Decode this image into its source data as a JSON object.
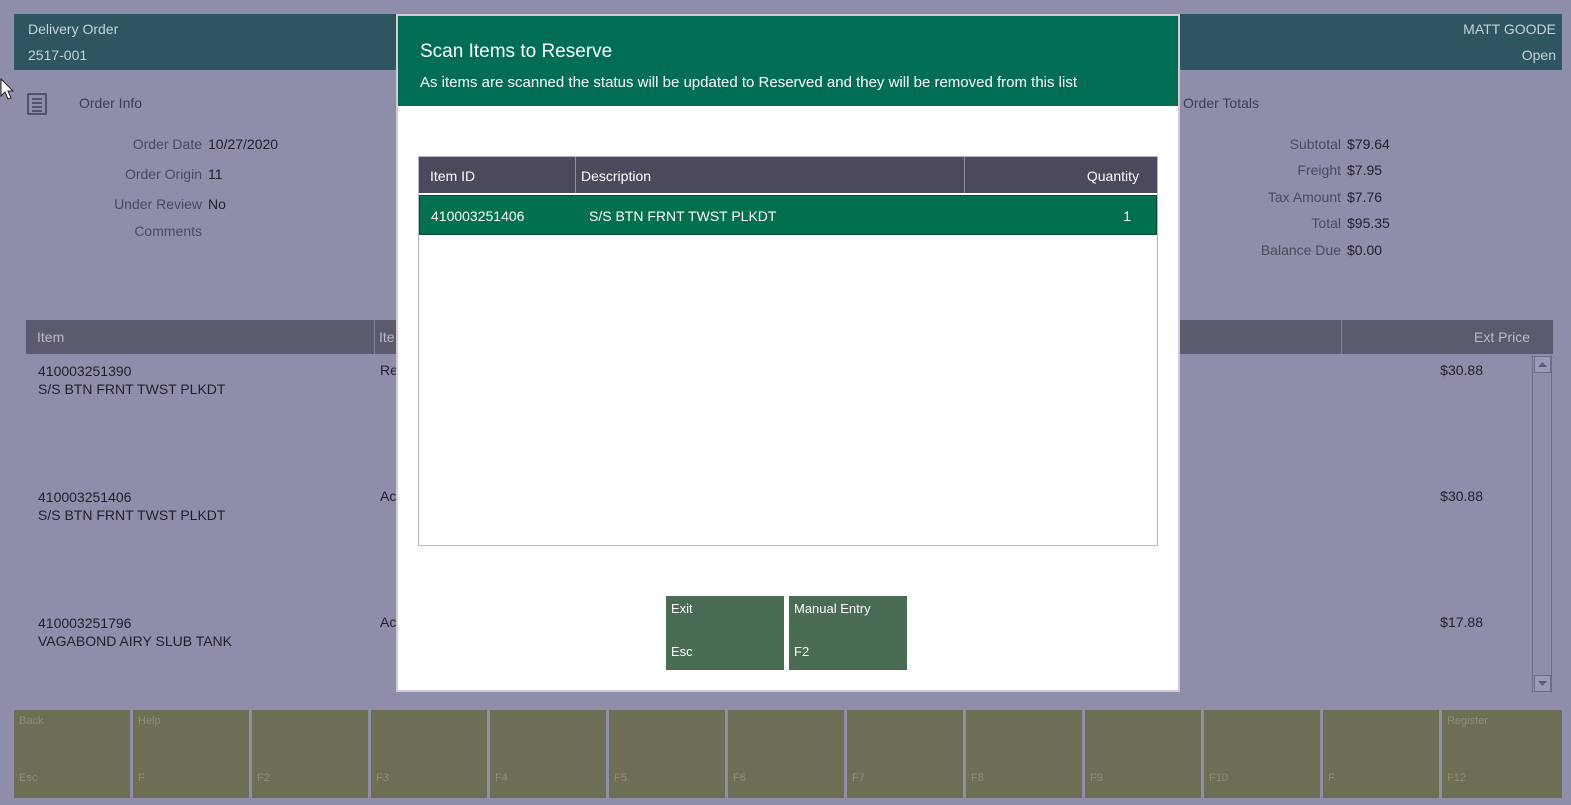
{
  "header": {
    "order_type": "Delivery Order",
    "order_number": "2517-001",
    "user_name": "MATT GOODE",
    "order_status": "Open"
  },
  "order_info": {
    "label": "Order Info",
    "fields": [
      {
        "label": "Order Date",
        "value": "10/27/2020"
      },
      {
        "label": "Order Origin",
        "value": "11"
      },
      {
        "label": "Under Review",
        "value": "No"
      },
      {
        "label": "Comments",
        "value": ""
      }
    ]
  },
  "order_totals": {
    "label": "Order Totals",
    "fields": [
      {
        "label": "Subtotal",
        "value": "$79.64"
      },
      {
        "label": "Freight",
        "value": "$7.95"
      },
      {
        "label": "Tax Amount",
        "value": "$7.76"
      },
      {
        "label": "Total",
        "value": "$95.35"
      },
      {
        "label": "Balance Due",
        "value": "$0.00"
      }
    ]
  },
  "lines": {
    "columns": {
      "item": "Item",
      "item_status": "Ite",
      "ext_price": "Ext Price"
    },
    "rows": [
      {
        "id": "410003251390",
        "desc": "S/S BTN FRNT TWST PLKDT",
        "status": "Re",
        "price": "$30.88"
      },
      {
        "id": "410003251406",
        "desc": "S/S BTN FRNT TWST PLKDT",
        "status": "Ac",
        "price": "$30.88"
      },
      {
        "id": "410003251796",
        "desc": "VAGABOND AIRY SLUB TANK",
        "status": "Ac",
        "price": "$17.88"
      }
    ]
  },
  "function_keys": [
    {
      "label": "Back",
      "key": "Esc"
    },
    {
      "label": "Help",
      "key": "F"
    },
    {
      "label": "",
      "key": "F2"
    },
    {
      "label": "",
      "key": "F3"
    },
    {
      "label": "",
      "key": "F4"
    },
    {
      "label": "",
      "key": "F5"
    },
    {
      "label": "",
      "key": "F6"
    },
    {
      "label": "",
      "key": "F7"
    },
    {
      "label": "",
      "key": "F8"
    },
    {
      "label": "",
      "key": "F9"
    },
    {
      "label": "",
      "key": "F10"
    },
    {
      "label": "",
      "key": "F"
    },
    {
      "label": "Register",
      "key": "F12"
    }
  ],
  "modal": {
    "title": "Scan Items to Reserve",
    "subtitle": "As items are scanned the status will be updated to Reserved and they will be removed from this list",
    "columns": {
      "item_id": "Item ID",
      "description": "Description",
      "quantity": "Quantity"
    },
    "rows": [
      {
        "item_id": "410003251406",
        "description": "S/S BTN FRNT TWST PLKDT",
        "quantity": "1"
      }
    ],
    "buttons": [
      {
        "label": "Exit",
        "key": "Esc"
      },
      {
        "label": "Manual Entry",
        "key": "F2"
      }
    ]
  },
  "colors": {
    "overlay": "#8e8eab",
    "modal_header": "#006e55",
    "selected_row": "#00704f",
    "modal_button": "#4a6b54",
    "fkey_bg": "#6e6e55"
  }
}
